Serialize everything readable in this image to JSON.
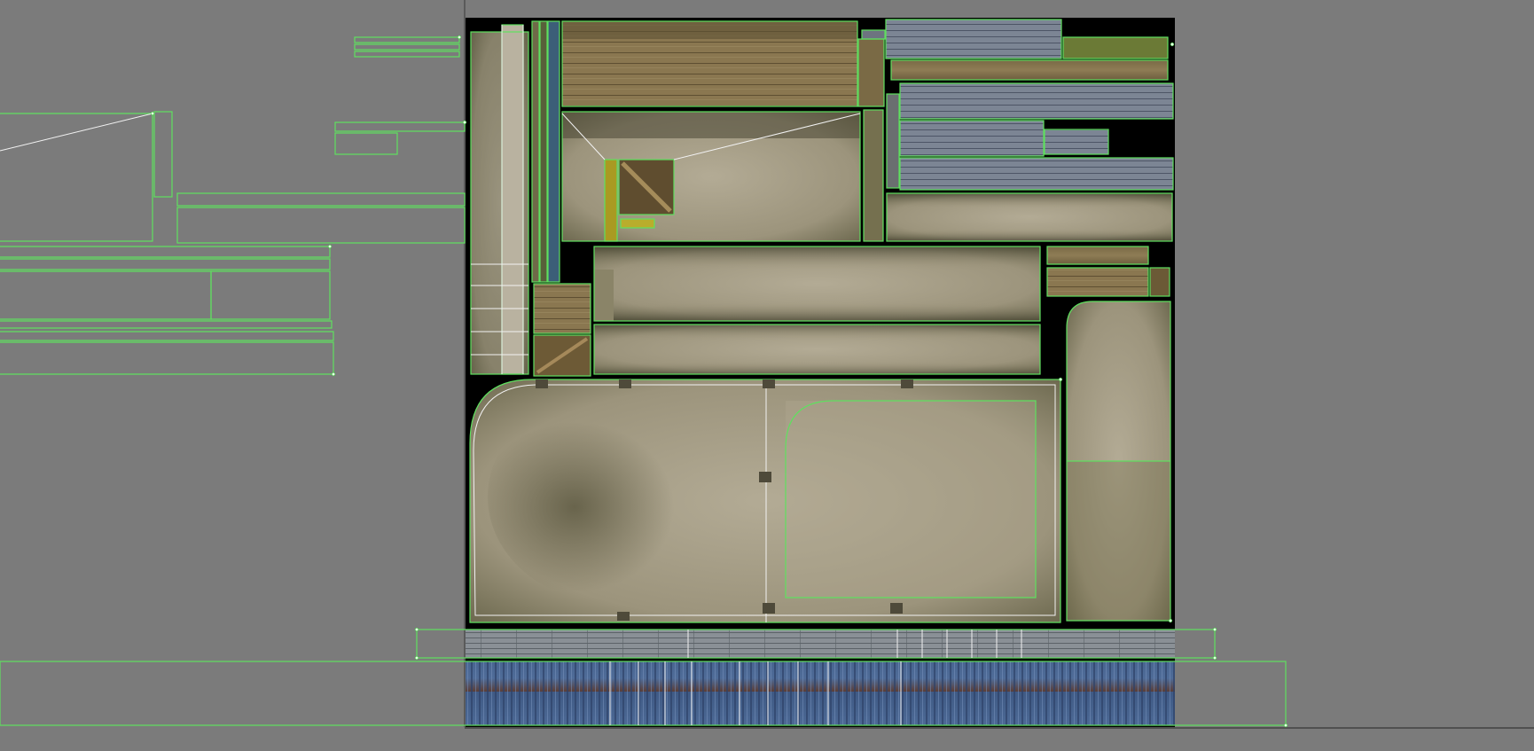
{
  "editor": {
    "panel": "uv-editor-viewport",
    "background_color": "#7b7b7b",
    "tile_color": "#000000",
    "uv_edge_color": "#5fe05f",
    "uv_vertex_color": "#ffffff",
    "icons": [
      "uv-island-icon",
      "texture-tile-icon"
    ]
  },
  "texture_palette": {
    "wood_light": "#8b7a55",
    "wood_dark": "#6f5f40",
    "plank_grey": "#7e8794",
    "concrete": "#a69e88",
    "concrete_dark": "#7a7a5a",
    "metal_blue": "#46628c",
    "yellow_board": "#b8a92a"
  }
}
